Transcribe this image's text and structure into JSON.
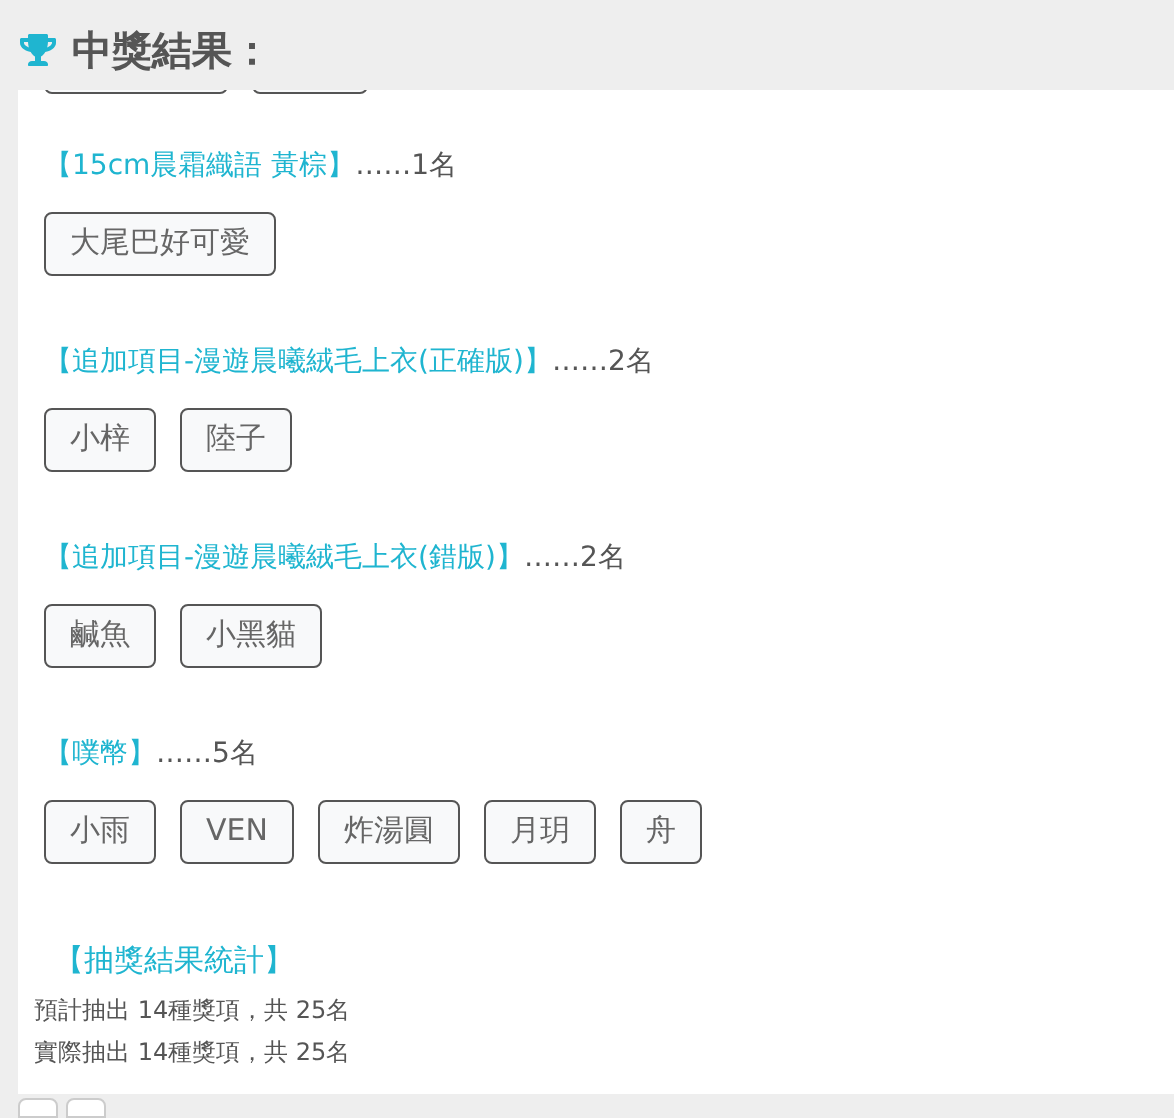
{
  "title": "中獎結果：",
  "prizes": [
    {
      "name": "【15cm晨霜織語 黃棕】",
      "count": "……1名",
      "winners": [
        "大尾巴好可愛"
      ]
    },
    {
      "name": "【追加項目-漫遊晨曦絨毛上衣(正確版)】",
      "count": "……2名",
      "winners": [
        "小梓",
        "陸子"
      ]
    },
    {
      "name": "【追加項目-漫遊晨曦絨毛上衣(錯版)】",
      "count": "……2名",
      "winners": [
        "鹹魚",
        "小黑貓"
      ]
    },
    {
      "name": "【噗幣】",
      "count": "……5名",
      "winners": [
        "小雨",
        "VEN",
        "炸湯圓",
        "月玥",
        "舟"
      ]
    }
  ],
  "summary": {
    "title": "【抽獎結果統計】",
    "lines": [
      "預計抽出 14種獎項，共 25名",
      "實際抽出 14種獎項，共 25名"
    ]
  }
}
